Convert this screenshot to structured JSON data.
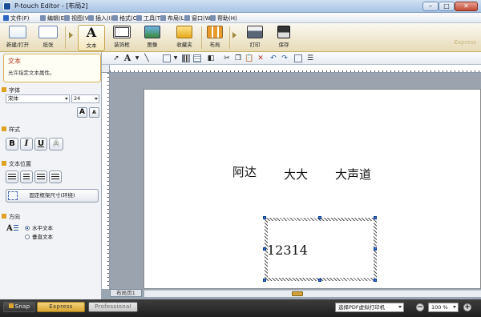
{
  "window": {
    "title": "P-touch Editor - [布局2]",
    "min": "–",
    "max": "□",
    "close": "✕"
  },
  "menu": [
    "文件(F)",
    "编辑(E)",
    "视图(V)",
    "插入(I)",
    "格式(O)",
    "工具(T)",
    "布局(L)",
    "窗口(W)",
    "帮助(H)"
  ],
  "ribbon": {
    "new_open": "新建/打开",
    "paper": "纸张",
    "text": "文本",
    "frame": "装饰框",
    "image": "图像",
    "clipart": "收藏夹",
    "layout": "布局",
    "print": "打印",
    "save": "保存",
    "edition": "Express"
  },
  "properties": {
    "title": "文本",
    "desc": "允许指定文本属性。",
    "font_section": "字体",
    "font_name": "宋体",
    "font_size": "24",
    "grow": "A",
    "shrink": "A",
    "style_section": "样式",
    "bold": "B",
    "italic": "I",
    "underline": "U",
    "outline": "A",
    "position_section": "文本位置",
    "fixed_frame": "固定框架尺寸(环绕)",
    "direction_section": "方向",
    "horizontal": "水平文本",
    "vertical": "垂直文本"
  },
  "document": {
    "texts": [
      "阿达",
      "大大",
      "大声道"
    ],
    "selected_text": "12314",
    "page_tab": "布局页1"
  },
  "status": {
    "snap": "Snap",
    "express": "Express",
    "professional": "Professional",
    "printer": "选择PDF虚拟打印机",
    "zoom": "100 %",
    "zoom_out": "−",
    "zoom_in": "+"
  }
}
